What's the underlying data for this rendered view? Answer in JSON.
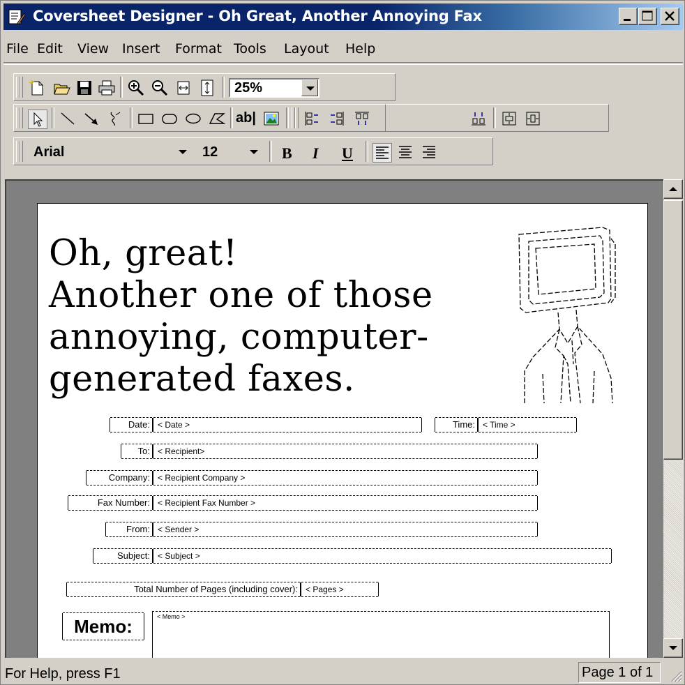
{
  "window": {
    "title": "Coversheet Designer - Oh Great, Another Annoying Fax"
  },
  "menu": [
    {
      "label": "File"
    },
    {
      "label": "Edit"
    },
    {
      "label": "View"
    },
    {
      "label": "Insert"
    },
    {
      "label": "Format"
    },
    {
      "label": "Tools"
    },
    {
      "label": "Layout"
    },
    {
      "label": "Help"
    }
  ],
  "toolbar": {
    "zoom_value": "25%",
    "text_tool_label": "ab|",
    "font_name": "Arial",
    "font_size": "12",
    "bold_label": "B",
    "italic_label": "I",
    "underline_label": "U"
  },
  "document": {
    "headline": [
      "Oh, great!",
      "Another one of those",
      "annoying, computer-",
      "generated faxes."
    ],
    "labels": {
      "date": "Date:",
      "time": "Time:",
      "to": "To:",
      "company": "Company:",
      "fax_number": "Fax Number:",
      "from": "From:",
      "subject": "Subject:",
      "total_pages": "Total Number of Pages (including cover):",
      "memo": "Memo:"
    },
    "fields": {
      "date": "< Date >",
      "time": "< Time >",
      "to": "< Recipient>",
      "company": "< Recipient Company >",
      "fax_number": "< Recipient Fax Number >",
      "from": "< Sender >",
      "subject": "< Subject >",
      "pages": "< Pages >",
      "memo": "< Memo >"
    }
  },
  "status": {
    "help_text": "For Help, press F1",
    "page_indicator": "Page 1 of 1"
  }
}
